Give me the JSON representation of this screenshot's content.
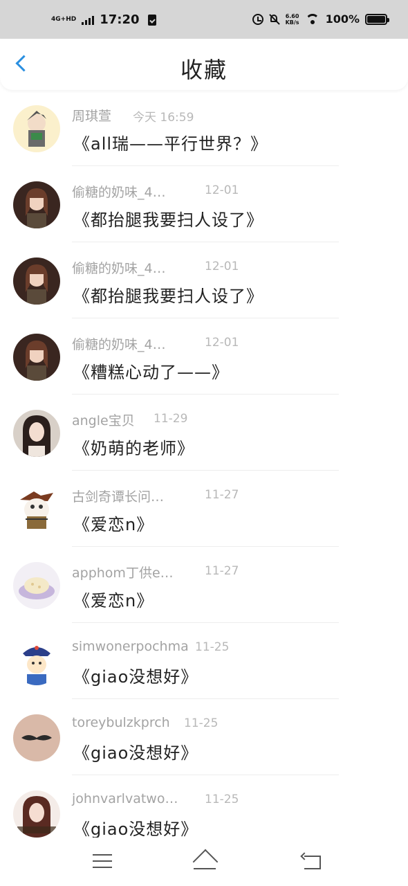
{
  "status_bar": {
    "network": "4G+HD",
    "time": "17:20",
    "speed_value": "6.60",
    "speed_unit": "KB/s",
    "battery": "100%"
  },
  "header": {
    "title": "收藏",
    "back_icon": "chevron-left-icon",
    "accent_color": "#2a8fe0"
  },
  "items": [
    {
      "name": "周琪萱",
      "time": "今天 16:59",
      "content": "《all瑞——平行世界？》"
    },
    {
      "name": "偷糖的奶味_4…",
      "time": "12-01",
      "content": "《都抬腿我要扫人设了》"
    },
    {
      "name": "偷糖的奶味_4…",
      "time": "12-01",
      "content": "《都抬腿我要扫人设了》"
    },
    {
      "name": "偷糖的奶味_4…",
      "time": "12-01",
      "content": "《糟糕心动了——》"
    },
    {
      "name": "angle宝贝",
      "time": "11-29",
      "content": "《奶萌的老师》"
    },
    {
      "name": "古剑奇谭长问…",
      "time": "11-27",
      "content": "《爱恋n》"
    },
    {
      "name": "apphom丁供e…",
      "time": "11-27",
      "content": "《爱恋n》"
    },
    {
      "name": "simwonerpochma",
      "time": "11-25",
      "content": "《giao没想好》"
    },
    {
      "name": "toreybulzkprch",
      "time": "11-25",
      "content": "《giao没想好》"
    },
    {
      "name": "johnvarlvatwo…",
      "time": "11-25",
      "content": "《giao没想好》"
    }
  ],
  "nav": {
    "menu_icon": "menu-icon",
    "home_icon": "home-icon",
    "back_icon": "back-icon"
  }
}
